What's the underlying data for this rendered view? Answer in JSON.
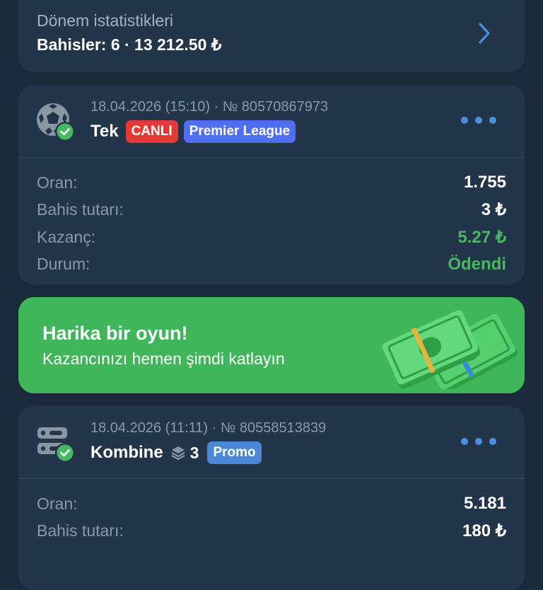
{
  "period_stats": {
    "title": "Dönem istatistikleri",
    "summary": "Bahisler: 6 · 13 212.50 ₺",
    "arrow_icon": "chevron-right-icon"
  },
  "bets": [
    {
      "icon": "football-icon",
      "status_icon": "check-circle-icon",
      "meta": "18.04.2026 (15:10) · № 80570867973",
      "type": "Tek",
      "tags": {
        "live": "CANLI",
        "league": "Premier League"
      },
      "rows": [
        {
          "label": "Oran:",
          "value": "1.755"
        },
        {
          "label": "Bahis tutarı:",
          "value": "3 ₺"
        },
        {
          "label": "Kazanç:",
          "value": "5.27 ₺"
        },
        {
          "label": "Durum:",
          "value": "Ödendi"
        }
      ]
    },
    {
      "icon": "combo-ticket-icon",
      "status_icon": "check-circle-icon",
      "meta": "18.04.2026 (11:11) · № 80558513839",
      "type": "Kombine",
      "legs_count": "3",
      "tags": {
        "promo": "Promo"
      },
      "rows": [
        {
          "label": "Oran:",
          "value": "5.181"
        },
        {
          "label": "Bahis tutarı:",
          "value": "180 ₺"
        }
      ]
    }
  ],
  "banner": {
    "title": "Harika bir oyun!",
    "subtitle": "Kazancınızı hemen şimdi katlayın",
    "art_icon": "money-stack-icon"
  },
  "colors": {
    "background": "#1a2a3b",
    "card": "#233649",
    "accent_blue": "#4a90e2",
    "success_green": "#47b861",
    "banner_green": "#3fb65a",
    "live_red": "#e53935",
    "league_blue": "#4f6ff0",
    "muted_text": "#8999ab"
  }
}
